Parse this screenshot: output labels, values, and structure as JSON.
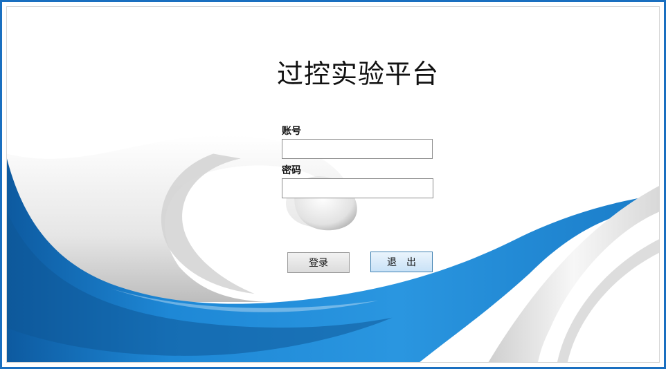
{
  "window": {
    "title": "过控实验平台"
  },
  "form": {
    "account_label": "账号",
    "account_value": "",
    "password_label": "密码",
    "password_value": ""
  },
  "buttons": {
    "login_label": "登录",
    "exit_label": "退　出"
  },
  "colors": {
    "frame_border": "#1a6fc0",
    "wave_blue": "#1e88d6",
    "wave_dark_blue": "#0f5fa8",
    "wave_white": "#f2f2f2",
    "exit_button_border": "#3c7fb1"
  }
}
